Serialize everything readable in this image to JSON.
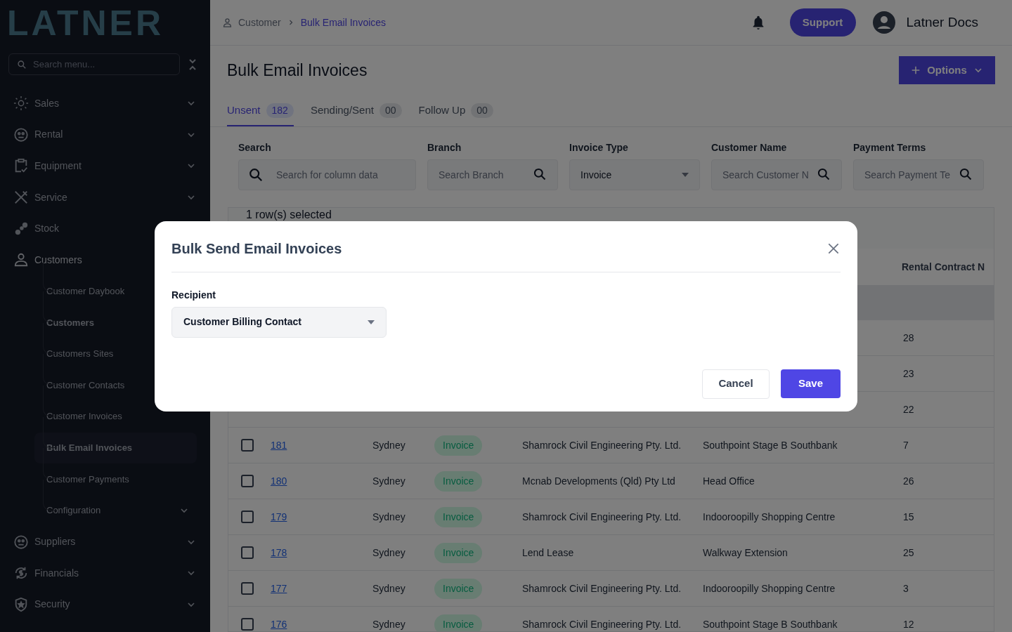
{
  "sidebar": {
    "logo": "LATNER",
    "search": {
      "placeholder": "Search menu..."
    },
    "items": [
      {
        "label": "Sales",
        "expanded": false
      },
      {
        "label": "Rental",
        "expanded": false
      },
      {
        "label": "Equipment",
        "expanded": false
      },
      {
        "label": "Service",
        "expanded": false
      },
      {
        "label": "Stock"
      },
      {
        "label": "Customers",
        "expanded": true,
        "children": [
          {
            "label": "Customer Daybook",
            "selected": false,
            "bold": false
          },
          {
            "label": "Customers",
            "selected": false,
            "bold": true
          },
          {
            "label": "Customers Sites",
            "selected": false,
            "bold": false
          },
          {
            "label": "Customer Contacts",
            "selected": false,
            "bold": false
          },
          {
            "label": "Customer Invoices",
            "selected": false,
            "bold": false
          },
          {
            "label": "Bulk Email Invoices",
            "selected": true,
            "bold": true
          },
          {
            "label": "Customer Payments",
            "selected": false,
            "bold": false
          },
          {
            "label": "Configuration",
            "selected": false,
            "bold": false,
            "expanded": false
          }
        ]
      },
      {
        "label": "Suppliers",
        "expanded": false
      },
      {
        "label": "Financials",
        "expanded": false
      },
      {
        "label": "Security",
        "expanded": false
      }
    ]
  },
  "header": {
    "breadcrumbs": [
      "Customer",
      "Bulk Email Invoices"
    ],
    "support_button": "Support",
    "user_name": "Latner Docs"
  },
  "page": {
    "title": "Bulk Email Invoices",
    "options_button": "Options",
    "tabs": [
      {
        "label": "Unsent",
        "count": "182",
        "selected": true
      },
      {
        "label": "Sending/Sent",
        "count": "00",
        "selected": false
      },
      {
        "label": "Follow Up",
        "count": "00",
        "selected": false
      }
    ],
    "filters": [
      {
        "kind": "search",
        "label": "Search",
        "placeholder": "Search for column data"
      },
      {
        "kind": "search-right",
        "label": "Branch",
        "placeholder": "Search Branch"
      },
      {
        "kind": "select",
        "label": "Invoice Type",
        "value": "Invoice"
      },
      {
        "kind": "search-right",
        "label": "Customer Name",
        "placeholder": "Search Customer N"
      },
      {
        "kind": "search-right",
        "label": "Payment Terms",
        "placeholder": "Search Payment Te"
      }
    ],
    "selection_text": "1 row(s) selected",
    "table": {
      "columns": {
        "column_6": "Rental Contract N"
      },
      "rows": [
        {
          "column_6": "28"
        },
        {
          "column_6": "23"
        },
        {
          "column_6": "22"
        },
        {
          "checked": false,
          "number": "181",
          "branch": "Sydney",
          "type": "Invoice",
          "customer": "Shamrock Civil Engineering Pty. Ltd.",
          "site": "Southpoint Stage B Southbank",
          "column_6": "7"
        },
        {
          "checked": false,
          "number": "180",
          "branch": "Sydney",
          "type": "Invoice",
          "customer": "Mcnab Developments (Qld) Pty Ltd",
          "site": "Head Office",
          "column_6": "26"
        },
        {
          "checked": false,
          "number": "179",
          "branch": "Sydney",
          "type": "Invoice",
          "customer": "Shamrock Civil Engineering Pty. Ltd.",
          "site": "Indooroopilly Shopping Centre",
          "column_6": "15"
        },
        {
          "checked": false,
          "number": "178",
          "branch": "Sydney",
          "type": "Invoice",
          "customer": "Lend Lease",
          "site": "Walkway Extension",
          "column_6": "25"
        },
        {
          "checked": false,
          "number": "177",
          "branch": "Sydney",
          "type": "Invoice",
          "customer": "Shamrock Civil Engineering Pty. Ltd.",
          "site": "Indooroopilly Shopping Centre",
          "column_6": "3"
        },
        {
          "checked": false,
          "number": "176",
          "branch": "Sydney",
          "type": "Invoice",
          "customer": "Shamrock Civil Engineering Pty. Ltd.",
          "site": "Southpoint Stage B Southbank",
          "column_6": "12"
        }
      ]
    }
  },
  "dialog": {
    "title": "Bulk Send Email Invoices",
    "recipient_label": "Recipient",
    "recipient_value": "Customer Billing Contact",
    "cancel_button": "Cancel",
    "save_button": "Save"
  }
}
